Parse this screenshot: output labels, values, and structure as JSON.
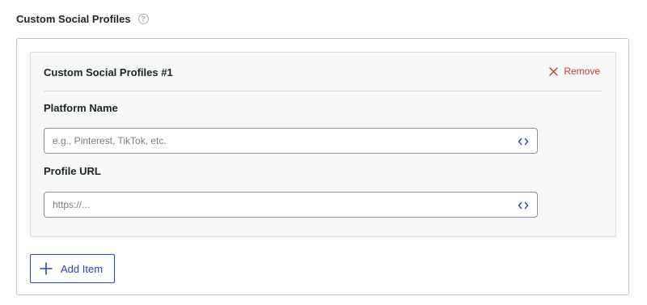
{
  "section": {
    "title": "Custom Social Profiles",
    "help_icon": "question-circle-icon",
    "help_glyph": "?"
  },
  "repeater": {
    "items": [
      {
        "title": "Custom Social Profiles #1",
        "remove_label": "Remove",
        "remove_icon": "close-icon",
        "fields": [
          {
            "label": "Platform Name",
            "value": "",
            "placeholder": "e.g., Pinterest, TikTok, etc.",
            "icon": "code-icon"
          },
          {
            "label": "Profile URL",
            "value": "",
            "placeholder": "https://...",
            "icon": "code-icon"
          }
        ]
      }
    ],
    "add_item_label": "Add Item",
    "add_item_icon": "plus-icon"
  },
  "colors": {
    "accent": "#2c3fc7",
    "danger": "#d63638",
    "border": "#c3c4c7",
    "item_background": "#f6f7f7",
    "text": "#1d2327",
    "placeholder": "#787c82"
  }
}
